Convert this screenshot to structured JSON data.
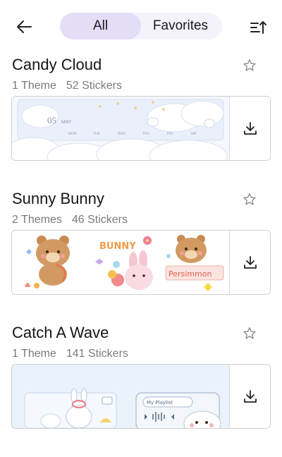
{
  "header": {
    "back_icon": "arrow-left-icon",
    "tabs": [
      {
        "label": "All",
        "active": true
      },
      {
        "label": "Favorites",
        "active": false
      }
    ],
    "sort_icon": "sort-upload-icon"
  },
  "packs": [
    {
      "title": "Candy Cloud",
      "themes": "1 Theme",
      "stickers": "52 Stickers",
      "preview_date": "05",
      "preview_month": "MAY",
      "preview_days": [
        "MON",
        "TUE",
        "WED",
        "THU",
        "FRI",
        "SAT"
      ]
    },
    {
      "title": "Sunny Bunny",
      "themes": "2 Themes",
      "stickers": "46 Stickers",
      "preview_word": "BUNNY",
      "preview_tag": "Persimmon"
    },
    {
      "title": "Catch A Wave",
      "themes": "1 Theme",
      "stickers": "141 Stickers",
      "preview_player": "My Playlist"
    }
  ],
  "colors": {
    "accent": "#e3ddf6",
    "segment_bg": "#f4f2fb",
    "meta_text": "#7a7a7a",
    "border": "#cfcfcf"
  }
}
